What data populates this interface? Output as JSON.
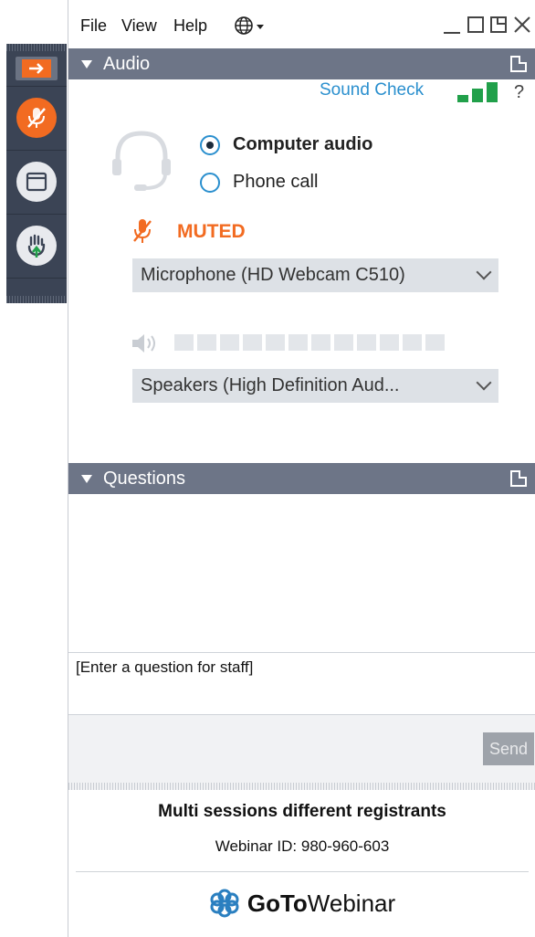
{
  "menu": {
    "file": "File",
    "view": "View",
    "help": "Help"
  },
  "audio": {
    "header": "Audio",
    "sound_check": "Sound Check",
    "help": "?",
    "options": [
      {
        "label": "Computer audio",
        "selected": true
      },
      {
        "label": "Phone call",
        "selected": false
      }
    ],
    "status": "MUTED",
    "microphone": "Microphone (HD Webcam C510)",
    "speakers": "Speakers (High Definition Aud...",
    "speaker_level_segments": 12
  },
  "questions": {
    "header": "Questions",
    "input_text": "[Enter a question for staff]",
    "send_label": "Send"
  },
  "footer": {
    "title": "Multi sessions different registrants",
    "webinar_id": "Webinar ID: 980-960-603",
    "brand_bold": "GoTo",
    "brand_rest": "Webinar"
  },
  "colors": {
    "accent": "#f26b21",
    "link": "#2a8fce",
    "panel_header": "#6d7587",
    "strip": "#3b4455",
    "signal": "#21a04a"
  }
}
